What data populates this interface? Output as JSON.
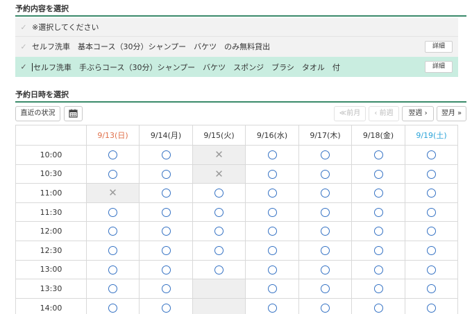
{
  "section1": {
    "title": "予約内容を選択"
  },
  "options": [
    {
      "label": "※選択してください",
      "selected": false,
      "detail": ""
    },
    {
      "label": "セルフ洗車　基本コース（30分）シャンプー　バケツ　のみ無料貸出",
      "selected": false,
      "detail": "詳細"
    },
    {
      "label": "セルフ洗車　手ぶらコース（30分）シャンプー　バケツ　スポンジ　ブラシ　タオル　付",
      "selected": true,
      "detail": "詳細"
    }
  ],
  "section2": {
    "title": "予約日時を選択"
  },
  "toolbar": {
    "recent_label": "直近の状況",
    "calendar_icon": "calendar-icon",
    "prev_month_label": "≪前月",
    "prev_week_label": "‹ 前週",
    "next_week_label": "翌週",
    "next_month_label": "翌月"
  },
  "calendar": {
    "days": [
      "9/13(日)",
      "9/14(月)",
      "9/15(火)",
      "9/16(水)",
      "9/17(木)",
      "9/18(金)",
      "9/19(土)"
    ],
    "times": [
      "10:00",
      "10:30",
      "11:00",
      "11:30",
      "12:00",
      "12:30",
      "13:00",
      "13:30",
      "14:00"
    ],
    "slots": [
      [
        "o",
        "o",
        "x",
        "o",
        "o",
        "o",
        "o"
      ],
      [
        "o",
        "o",
        "x",
        "o",
        "o",
        "o",
        "o"
      ],
      [
        "x",
        "o",
        "o",
        "o",
        "o",
        "o",
        "o"
      ],
      [
        "o",
        "o",
        "o",
        "o",
        "o",
        "o",
        "o"
      ],
      [
        "o",
        "o",
        "o",
        "o",
        "o",
        "o",
        "o"
      ],
      [
        "o",
        "o",
        "o",
        "o",
        "o",
        "o",
        "o"
      ],
      [
        "o",
        "o",
        "o",
        "o",
        "o",
        "o",
        "o"
      ],
      [
        "o",
        "o",
        "-",
        "o",
        "o",
        "o",
        "o"
      ],
      [
        "o",
        "o",
        "-",
        "o",
        "o",
        "o",
        "o"
      ]
    ]
  },
  "colors": {
    "accent_line": "#3a8a6a",
    "selected_row": "#c9ede0",
    "available": "#3572c4",
    "sunday": "#e0704a",
    "saturday": "#2aa3d8"
  }
}
